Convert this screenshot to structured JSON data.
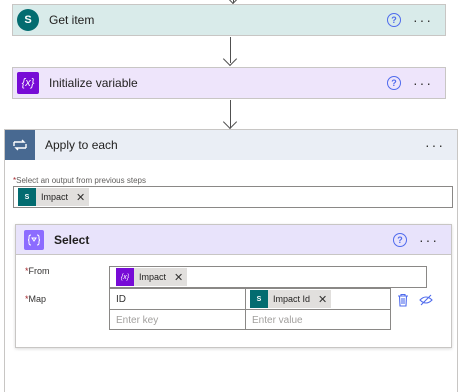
{
  "steps": {
    "get_item": {
      "title": "Get item",
      "icon_letter": "S",
      "header_color": "#d9ebea",
      "icon_color": "#036c70"
    },
    "init_variable": {
      "title": "Initialize variable",
      "icon_text": "{x}",
      "header_color": "#eee5fb",
      "icon_color": "#770bd6"
    }
  },
  "apply_each": {
    "title": "Apply to each",
    "output_label": "Select an output from previous steps",
    "output_token": "Impact"
  },
  "select": {
    "title": "Select",
    "from_label": "From",
    "from_token": "Impact",
    "map_label": "Map",
    "map": {
      "key_1": "ID",
      "value_1_token": "Impact Id",
      "key_placeholder": "Enter key",
      "value_placeholder": "Enter value"
    }
  },
  "icons": {
    "help": "?",
    "more": "···",
    "close": "✕",
    "req": "*"
  }
}
